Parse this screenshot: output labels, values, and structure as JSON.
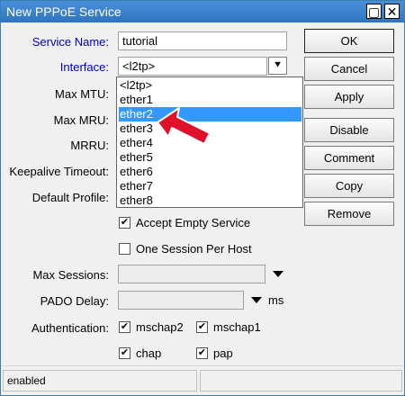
{
  "window": {
    "title": "New PPPoE Service",
    "restore_glyph": "▢",
    "close_glyph": "✕"
  },
  "form": {
    "service_name_label": "Service Name:",
    "service_name_value": "tutorial",
    "interface_label": "Interface:",
    "interface_value": "<l2tp>",
    "interface_dropdown_glyph": "⯆",
    "interface_options": [
      "<l2tp>",
      "ether1",
      "ether2",
      "ether3",
      "ether4",
      "ether5",
      "ether6",
      "ether7",
      "ether8"
    ],
    "selected_option": "ether2",
    "max_mtu_label": "Max MTU:",
    "max_mru_label": "Max MRU:",
    "mrru_label": "MRRU:",
    "keepalive_label": "Keepalive Timeout:",
    "default_profile_label": "Default Profile:",
    "accept_empty_label": "Accept Empty Service",
    "accept_empty_checked": true,
    "one_session_label": "One Session Per Host",
    "one_session_checked": false,
    "max_sessions_label": "Max Sessions:",
    "pado_delay_label": "PADO Delay:",
    "pado_unit": "ms",
    "authentication_label": "Authentication:",
    "auth": [
      {
        "label": "mschap2",
        "checked": true
      },
      {
        "label": "mschap1",
        "checked": true
      },
      {
        "label": "chap",
        "checked": true
      },
      {
        "label": "pap",
        "checked": true
      }
    ],
    "check_glyph": "✔"
  },
  "buttons": {
    "ok": "OK",
    "cancel": "Cancel",
    "apply": "Apply",
    "disable": "Disable",
    "comment": "Comment",
    "copy": "Copy",
    "remove": "Remove"
  },
  "status": {
    "text": "enabled"
  },
  "colors": {
    "selection": "#3399ff",
    "label_blue": "#0000c0",
    "arrow": "#e0102a"
  }
}
